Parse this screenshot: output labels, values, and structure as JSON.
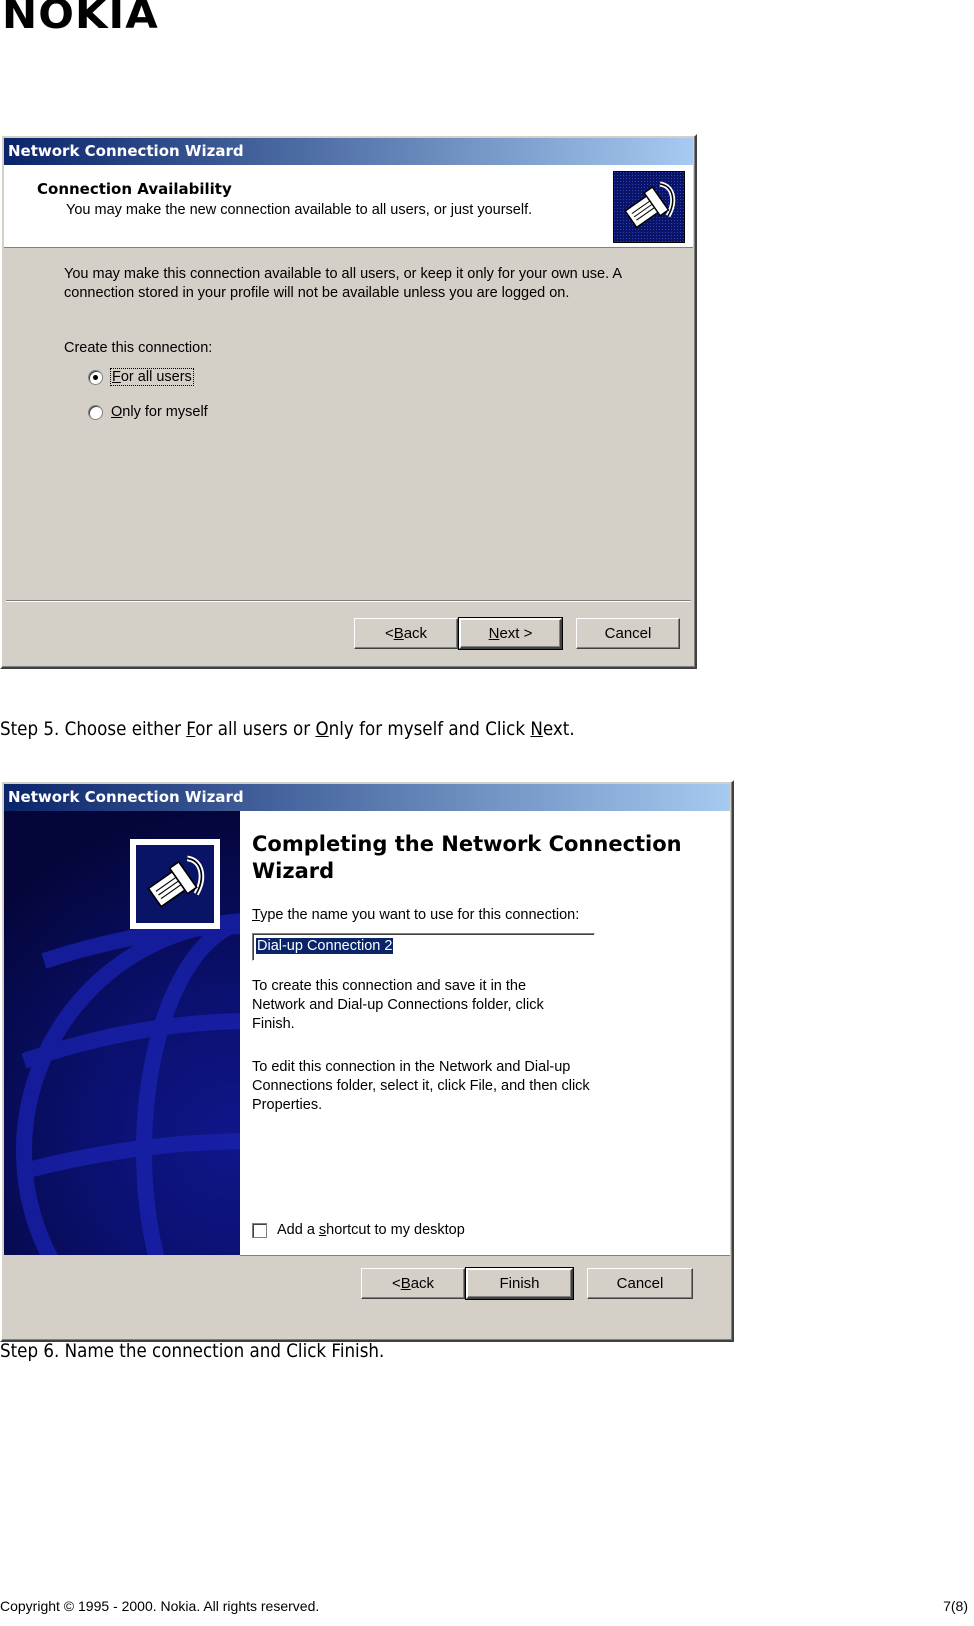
{
  "brand": {
    "logo_text": "NOKIA"
  },
  "dialog1": {
    "title": "Network Connection Wizard",
    "header_title": "Connection Availability",
    "header_subtitle": "You may make the new connection available to all users, or just yourself.",
    "body_line1": "You may make this connection available to all users, or keep it only for your own use.  A",
    "body_line2": "connection stored in your profile will not be available unless you are logged on.",
    "group_label": "Create this connection:",
    "options": [
      {
        "label_accel": "F",
        "label_rest": "or all users",
        "selected": true
      },
      {
        "label_accel": "O",
        "label_rest": "nly for myself",
        "selected": false
      }
    ],
    "buttons": {
      "back_prefix": "< ",
      "back_accel": "B",
      "back_rest": "ack",
      "next_accel": "N",
      "next_rest": "ext >",
      "cancel": "Cancel"
    },
    "icon": "network-cable-icon"
  },
  "caption1": {
    "prefix": "Step 5. Choose either ",
    "opt1_accel": "F",
    "opt1_rest": "or all users",
    "middle": " or ",
    "opt2_accel": "O",
    "opt2_rest": "nly for myself",
    "middle2": " and Click ",
    "next_accel": "N",
    "next_rest": "ext."
  },
  "dialog2": {
    "title": "Network Connection Wizard",
    "heading_line1": "Completing the Network Connection",
    "heading_line2": "Wizard",
    "name_label_accel": "T",
    "name_label_rest": "ype the name you want to use for this connection:",
    "name_value": "Dial-up Connection 2",
    "para1_line1": "To create this connection and save it in the",
    "para1_line2": "Network and Dial-up Connections folder, click",
    "para1_line3": "Finish.",
    "para2_line1": "To edit this connection in the Network and Dial-up",
    "para2_line2": "Connections folder, select it, click File, and then click",
    "para2_line3": "Properties.",
    "shortcut_prefix": "Add a ",
    "shortcut_accel": "s",
    "shortcut_rest": "hortcut to my desktop",
    "shortcut_checked": false,
    "buttons": {
      "back_prefix": "< ",
      "back_accel": "B",
      "back_rest": "ack",
      "finish": "Finish",
      "cancel": "Cancel"
    },
    "icon": "network-cable-icon",
    "side_graphic": "globe-graphic"
  },
  "caption2": {
    "text": "Step 6. Name the connection and Click Finish."
  },
  "footer": {
    "copyright": "Copyright © 1995 - 2000. Nokia. All rights reserved.",
    "page": "7(8)"
  },
  "colors": {
    "titlebar_start": "#0a246a",
    "titlebar_end": "#a6caf0",
    "dialog_bg": "#d4d0c8",
    "side_panel": "#0a106e"
  }
}
